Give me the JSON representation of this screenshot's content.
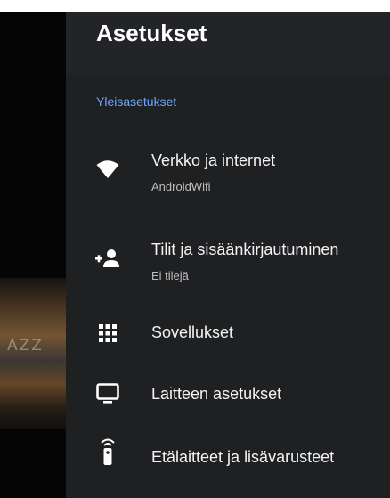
{
  "panel": {
    "title": "Asetukset",
    "section_label": "Yleisasetukset"
  },
  "background": {
    "art_text": "AZZ"
  },
  "items": [
    {
      "title": "Verkko ja internet",
      "subtitle": "AndroidWifi",
      "icon": "wifi-icon"
    },
    {
      "title": "Tilit ja sisäänkirjautuminen",
      "subtitle": "Ei tilejä",
      "icon": "add-account-icon"
    },
    {
      "title": "Sovellukset",
      "icon": "apps-grid-icon"
    },
    {
      "title": "Laitteen asetukset",
      "icon": "tv-icon"
    },
    {
      "title": "Etälaitteet ja lisävarusteet",
      "icon": "remote-icon"
    }
  ],
  "colors": {
    "panel_bg": "#1f2022",
    "header_bg": "#232427",
    "accent": "#6ea8ff",
    "text": "#f2f2f2"
  }
}
